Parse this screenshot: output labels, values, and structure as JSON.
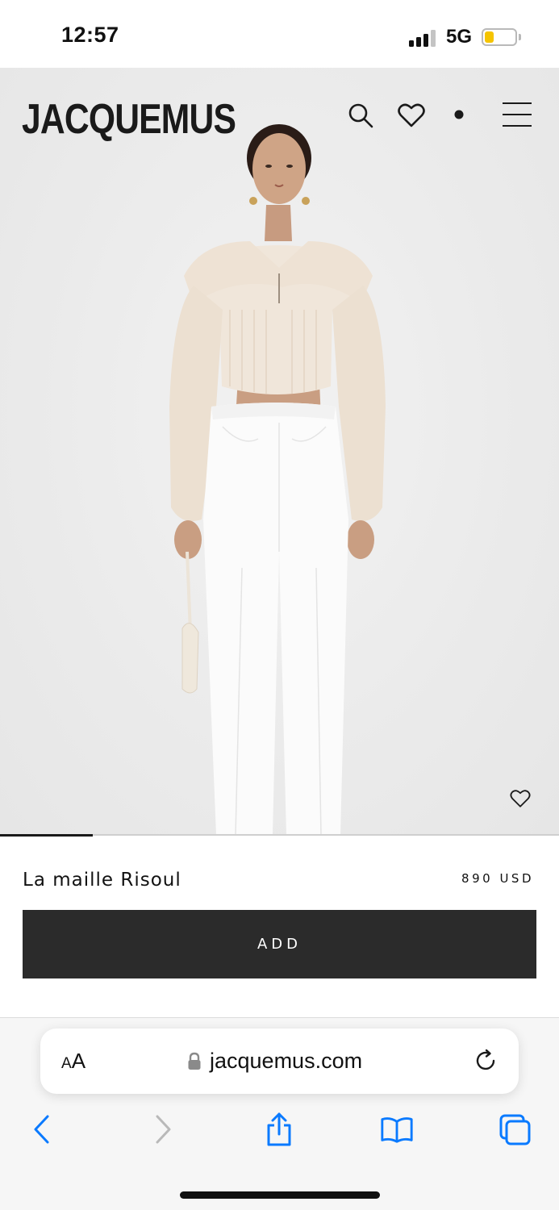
{
  "status_bar": {
    "time": "12:57",
    "network": "5G",
    "signal_bars_active": 3,
    "signal_bars_total": 4,
    "battery_level": 0.3,
    "battery_color": "#f5c400"
  },
  "header": {
    "brand": "JACQUEMUS",
    "icons": [
      "search-icon",
      "heart-icon",
      "dot-icon",
      "menu-icon"
    ]
  },
  "hero": {
    "favorite_icon": "heart-outline-icon",
    "gallery_progress": 0.166
  },
  "product": {
    "name": "La maille Risoul",
    "price": "890 USD",
    "add_label": "ADD"
  },
  "browser": {
    "text_size_label_large": "A",
    "text_size_label_small": "A",
    "url": "jacquemus.com",
    "accent_color": "#0a7aff"
  }
}
